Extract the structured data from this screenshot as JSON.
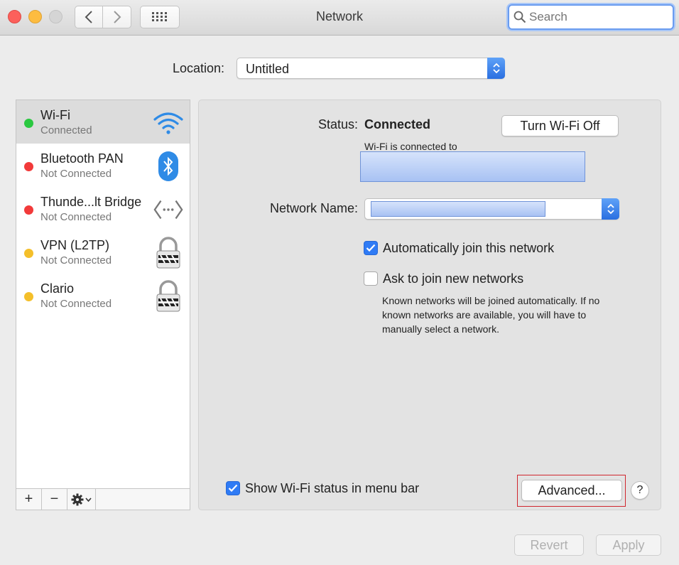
{
  "window": {
    "title": "Network"
  },
  "search": {
    "placeholder": "Search"
  },
  "location": {
    "label": "Location:",
    "value": "Untitled"
  },
  "services": [
    {
      "name": "Wi-Fi",
      "status": "Connected",
      "dot_color": "#2ac840",
      "icon": "wifi-icon",
      "selected": true
    },
    {
      "name": "Bluetooth PAN",
      "status": "Not Connected",
      "dot_color": "#f23a3a",
      "icon": "bluetooth-icon",
      "selected": false
    },
    {
      "name": "Thunde...lt Bridge",
      "status": "Not Connected",
      "dot_color": "#f23a3a",
      "icon": "bridge-arrows-icon",
      "selected": false
    },
    {
      "name": "VPN (L2TP)",
      "status": "Not Connected",
      "dot_color": "#f4bf2a",
      "icon": "lock-icon",
      "selected": false
    },
    {
      "name": "Clario",
      "status": "Not Connected",
      "dot_color": "#f4bf2a",
      "icon": "lock-icon",
      "selected": false
    }
  ],
  "sidebar_footer": {
    "add": "+",
    "remove": "−"
  },
  "detail": {
    "status_label": "Status:",
    "status_value": "Connected",
    "toggle_button": "Turn Wi-Fi Off",
    "connected_to_text": "Wi-Fi is connected to",
    "network_name_label": "Network Name:",
    "auto_join_label": "Automatically join this network",
    "auto_join_checked": true,
    "ask_join_label": "Ask to join new networks",
    "ask_join_checked": false,
    "ask_join_help": "Known networks will be joined automatically. If no known networks are available, you will have to manually select a network.",
    "show_status_label": "Show Wi-Fi status in menu bar",
    "show_status_checked": true,
    "advanced_button": "Advanced...",
    "help_button": "?"
  },
  "footer": {
    "revert": "Revert",
    "apply": "Apply"
  }
}
